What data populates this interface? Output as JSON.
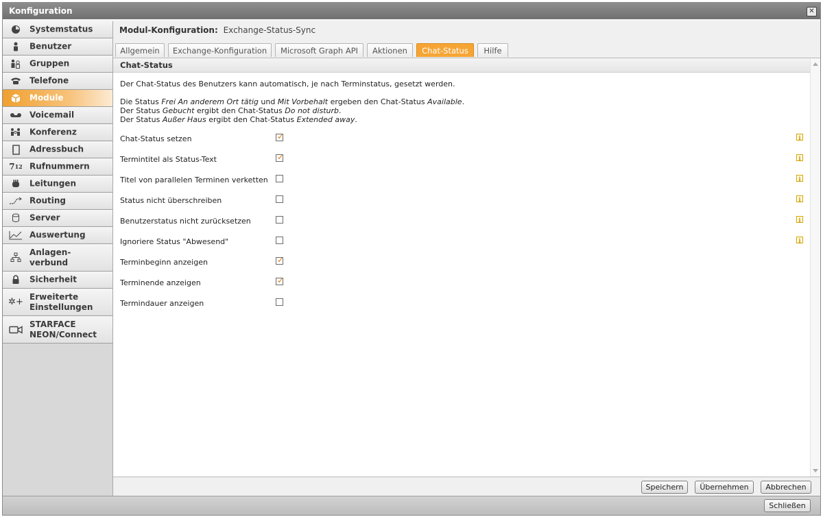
{
  "window": {
    "title": "Konfiguration",
    "close_icon": "close-icon"
  },
  "sidebar": {
    "items": [
      {
        "label": "Systemstatus",
        "icon": "dashboard-icon"
      },
      {
        "label": "Benutzer",
        "icon": "user-icon"
      },
      {
        "label": "Gruppen",
        "icon": "group-icon"
      },
      {
        "label": "Telefone",
        "icon": "phone-icon"
      },
      {
        "label": "Module",
        "icon": "cube-icon",
        "active": true
      },
      {
        "label": "Voicemail",
        "icon": "voicemail-icon"
      },
      {
        "label": "Konferenz",
        "icon": "conference-icon"
      },
      {
        "label": "Adressbuch",
        "icon": "addressbook-icon"
      },
      {
        "label": "Rufnummern",
        "icon": "numbers-icon"
      },
      {
        "label": "Leitungen",
        "icon": "lines-icon"
      },
      {
        "label": "Routing",
        "icon": "routing-icon"
      },
      {
        "label": "Server",
        "icon": "server-icon"
      },
      {
        "label": "Auswertung",
        "icon": "chart-icon"
      },
      {
        "label": "Anlagen-\nverbund",
        "icon": "network-icon"
      },
      {
        "label": "Sicherheit",
        "icon": "lock-icon"
      },
      {
        "label": "Erweiterte\nEinstellungen",
        "icon": "settings-plus-icon"
      },
      {
        "label": "STARFACE\nNEON/Connect",
        "icon": "camera-icon"
      }
    ]
  },
  "module": {
    "heading_label": "Modul-Konfiguration:",
    "heading_value": "Exchange-Status-Sync"
  },
  "tabs": [
    {
      "label": "Allgemein"
    },
    {
      "label": "Exchange-Konfiguration"
    },
    {
      "label": "Microsoft Graph API"
    },
    {
      "label": "Aktionen"
    },
    {
      "label": "Chat-Status",
      "active": true
    },
    {
      "label": "Hilfe"
    }
  ],
  "section": {
    "title": "Chat-Status",
    "intro": "Der Chat-Status des Benutzers kann automatisch, je nach Terminstatus, gesetzt werden.",
    "line1": {
      "a": "Die Status ",
      "b": "Frei An anderem Ort tätig",
      "c": " und ",
      "d": "Mit Vorbehalt",
      "e": " ergeben den Chat-Status ",
      "f": "Available",
      "g": "."
    },
    "line2": {
      "a": "Der Status ",
      "b": "Gebucht",
      "c": " ergibt den Chat-Status ",
      "d": "Do not disturb",
      "e": "."
    },
    "line3": {
      "a": "Der Status ",
      "b": "Außer Haus",
      "c": " ergibt den Chat-Status ",
      "d": "Extended away",
      "e": "."
    }
  },
  "options": [
    {
      "label": "Chat-Status setzen",
      "checked": true,
      "info": true
    },
    {
      "label": "Termintitel als Status-Text",
      "checked": true,
      "info": true
    },
    {
      "label": "Titel von parallelen Terminen verketten",
      "checked": false,
      "info": true
    },
    {
      "label": "Status nicht überschreiben",
      "checked": false,
      "info": true
    },
    {
      "label": "Benutzerstatus nicht zurücksetzen",
      "checked": false,
      "info": true
    },
    {
      "label": "Ignoriere Status \"Abwesend\"",
      "checked": false,
      "info": true
    },
    {
      "label": "Terminbeginn anzeigen",
      "checked": true,
      "info": false
    },
    {
      "label": "Terminende anzeigen",
      "checked": true,
      "info": false
    },
    {
      "label": "Termindauer anzeigen",
      "checked": false,
      "info": false
    }
  ],
  "buttons": {
    "save": "Speichern",
    "apply": "Übernehmen",
    "cancel": "Abbrechen",
    "close": "Schließen"
  },
  "info_glyph": "i",
  "check_glyph": "✓",
  "colors": {
    "accent": "#f6a535",
    "info": "#d9a400",
    "check": "#e07a10"
  }
}
